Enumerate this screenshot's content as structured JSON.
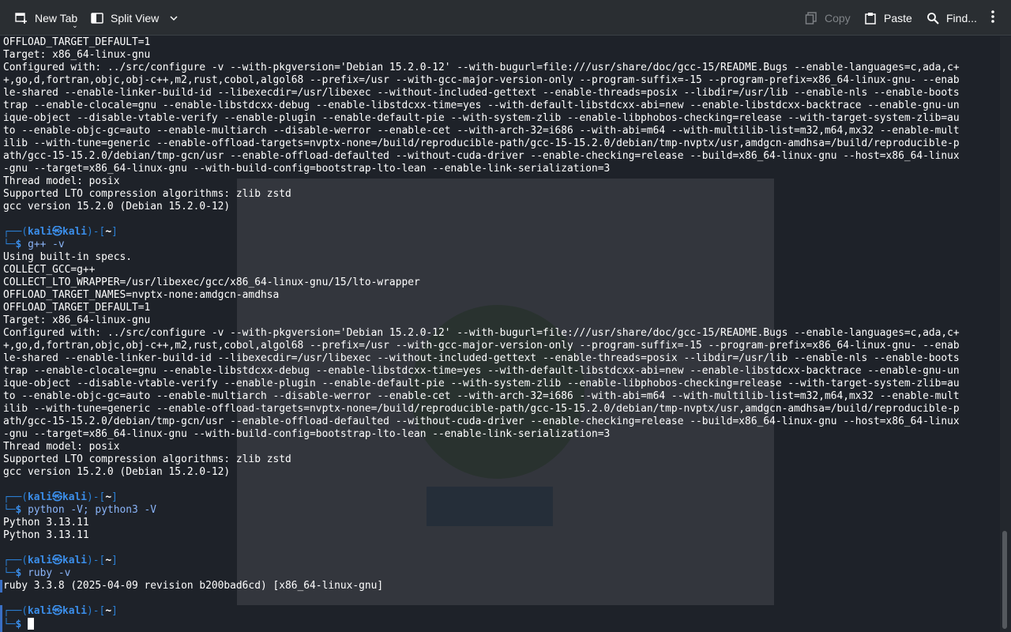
{
  "toolbar": {
    "new_tab_label": "New Tab",
    "split_view_label": "Split View",
    "copy_label": "Copy",
    "paste_label": "Paste",
    "find_label": "Find...",
    "icons": {
      "new_tab": "new-tab-icon",
      "split_view": "split-view-icon",
      "copy": "copy-icon",
      "paste": "paste-icon",
      "find": "search-icon",
      "menu": "kebab-menu-icon"
    }
  },
  "terminal": {
    "prompt": {
      "user": "kali",
      "host": "kali",
      "dir": "~",
      "skull": "㉿"
    },
    "lines": [
      {
        "type": "text",
        "text": "OFFLOAD_TARGET_DEFAULT=1"
      },
      {
        "type": "text",
        "text": "Target: x86_64-linux-gnu"
      },
      {
        "type": "text",
        "text": "Configured with: ../src/configure -v --with-pkgversion='Debian 15.2.0-12' --with-bugurl=file:///usr/share/doc/gcc-15/README.Bugs --enable-languages=c,ada,c+"
      },
      {
        "type": "text",
        "text": "+,go,d,fortran,objc,obj-c++,m2,rust,cobol,algol68 --prefix=/usr --with-gcc-major-version-only --program-suffix=-15 --program-prefix=x86_64-linux-gnu- --enab"
      },
      {
        "type": "text",
        "text": "le-shared --enable-linker-build-id --libexecdir=/usr/libexec --without-included-gettext --enable-threads=posix --libdir=/usr/lib --enable-nls --enable-boots"
      },
      {
        "type": "text",
        "text": "trap --enable-clocale=gnu --enable-libstdcxx-debug --enable-libstdcxx-time=yes --with-default-libstdcxx-abi=new --enable-libstdcxx-backtrace --enable-gnu-un"
      },
      {
        "type": "text",
        "text": "ique-object --disable-vtable-verify --enable-plugin --enable-default-pie --with-system-zlib --enable-libphobos-checking=release --with-target-system-zlib=au"
      },
      {
        "type": "text",
        "text": "to --enable-objc-gc=auto --enable-multiarch --disable-werror --enable-cet --with-arch-32=i686 --with-abi=m64 --with-multilib-list=m32,m64,mx32 --enable-mult"
      },
      {
        "type": "text",
        "text": "ilib --with-tune=generic --enable-offload-targets=nvptx-none=/build/reproducible-path/gcc-15-15.2.0/debian/tmp-nvptx/usr,amdgcn-amdhsa=/build/reproducible-p"
      },
      {
        "type": "text",
        "text": "ath/gcc-15-15.2.0/debian/tmp-gcn/usr --enable-offload-defaulted --without-cuda-driver --enable-checking=release --build=x86_64-linux-gnu --host=x86_64-linux"
      },
      {
        "type": "text",
        "text": "-gnu --target=x86_64-linux-gnu --with-build-config=bootstrap-lto-lean --enable-link-serialization=3"
      },
      {
        "type": "text",
        "text": "Thread model: posix"
      },
      {
        "type": "text",
        "text": "Supported LTO compression algorithms: zlib zstd"
      },
      {
        "type": "text",
        "text": "gcc version 15.2.0 (Debian 15.2.0-12)"
      },
      {
        "type": "blank",
        "text": ""
      },
      {
        "type": "prompt",
        "text": ""
      },
      {
        "type": "cmd",
        "text": "g++ -v"
      },
      {
        "type": "text",
        "text": "Using built-in specs."
      },
      {
        "type": "text",
        "text": "COLLECT_GCC=g++"
      },
      {
        "type": "text",
        "text": "COLLECT_LTO_WRAPPER=/usr/libexec/gcc/x86_64-linux-gnu/15/lto-wrapper"
      },
      {
        "type": "text",
        "text": "OFFLOAD_TARGET_NAMES=nvptx-none:amdgcn-amdhsa"
      },
      {
        "type": "text",
        "text": "OFFLOAD_TARGET_DEFAULT=1"
      },
      {
        "type": "text",
        "text": "Target: x86_64-linux-gnu"
      },
      {
        "type": "text",
        "text": "Configured with: ../src/configure -v --with-pkgversion='Debian 15.2.0-12' --with-bugurl=file:///usr/share/doc/gcc-15/README.Bugs --enable-languages=c,ada,c+"
      },
      {
        "type": "text",
        "text": "+,go,d,fortran,objc,obj-c++,m2,rust,cobol,algol68 --prefix=/usr --with-gcc-major-version-only --program-suffix=-15 --program-prefix=x86_64-linux-gnu- --enab"
      },
      {
        "type": "text",
        "text": "le-shared --enable-linker-build-id --libexecdir=/usr/libexec --without-included-gettext --enable-threads=posix --libdir=/usr/lib --enable-nls --enable-boots"
      },
      {
        "type": "text",
        "text": "trap --enable-clocale=gnu --enable-libstdcxx-debug --enable-libstdcxx-time=yes --with-default-libstdcxx-abi=new --enable-libstdcxx-backtrace --enable-gnu-un"
      },
      {
        "type": "text",
        "text": "ique-object --disable-vtable-verify --enable-plugin --enable-default-pie --with-system-zlib --enable-libphobos-checking=release --with-target-system-zlib=au"
      },
      {
        "type": "text",
        "text": "to --enable-objc-gc=auto --enable-multiarch --disable-werror --enable-cet --with-arch-32=i686 --with-abi=m64 --with-multilib-list=m32,m64,mx32 --enable-mult"
      },
      {
        "type": "text",
        "text": "ilib --with-tune=generic --enable-offload-targets=nvptx-none=/build/reproducible-path/gcc-15-15.2.0/debian/tmp-nvptx/usr,amdgcn-amdhsa=/build/reproducible-p"
      },
      {
        "type": "text",
        "text": "ath/gcc-15-15.2.0/debian/tmp-gcn/usr --enable-offload-defaulted --without-cuda-driver --enable-checking=release --build=x86_64-linux-gnu --host=x86_64-linux"
      },
      {
        "type": "text",
        "text": "-gnu --target=x86_64-linux-gnu --with-build-config=bootstrap-lto-lean --enable-link-serialization=3"
      },
      {
        "type": "text",
        "text": "Thread model: posix"
      },
      {
        "type": "text",
        "text": "Supported LTO compression algorithms: zlib zstd"
      },
      {
        "type": "text",
        "text": "gcc version 15.2.0 (Debian 15.2.0-12)"
      },
      {
        "type": "blank",
        "text": ""
      },
      {
        "type": "prompt",
        "text": ""
      },
      {
        "type": "cmd",
        "text": "python -V; python3 -V"
      },
      {
        "type": "text",
        "text": "Python 3.13.11"
      },
      {
        "type": "text",
        "text": "Python 3.13.11"
      },
      {
        "type": "blank",
        "text": ""
      },
      {
        "type": "prompt",
        "text": ""
      },
      {
        "type": "cmd",
        "text": "ruby -v"
      },
      {
        "type": "text",
        "text": "ruby 3.3.8 (2025-04-09 revision b200bad6cd) [x86_64-linux-gnu]"
      },
      {
        "type": "blank",
        "text": ""
      },
      {
        "type": "prompt",
        "text": ""
      },
      {
        "type": "input",
        "text": ""
      }
    ]
  },
  "colors": {
    "terminal_bg": "#1e2229",
    "toolbar_bg": "#2a2e32",
    "prompt_blue": "#3b8eea",
    "command_color": "#8ab4f8",
    "text": "#ffffff"
  }
}
